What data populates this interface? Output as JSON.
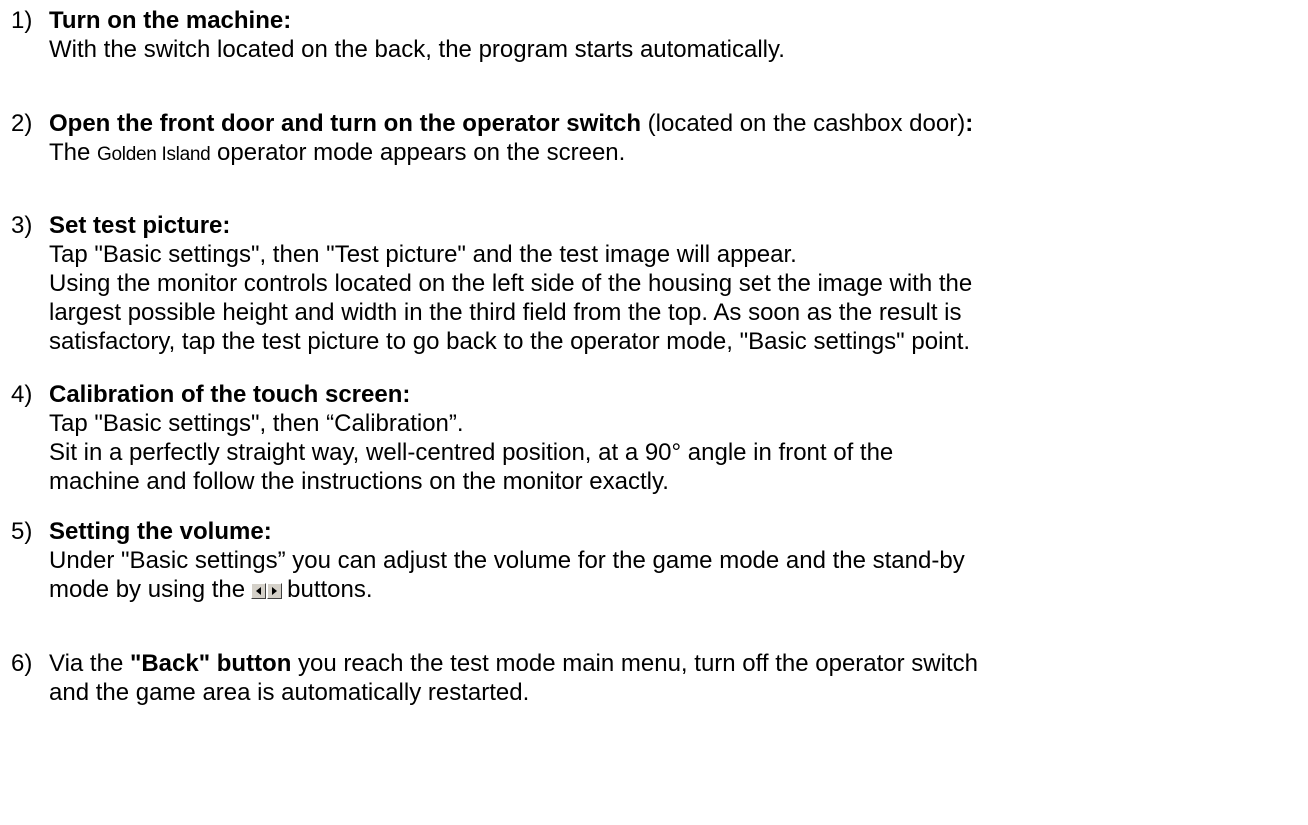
{
  "steps": [
    {
      "num": "1)",
      "title": "Turn on the machine:",
      "lines": [
        "With the switch located on the back, the program starts automatically."
      ]
    },
    {
      "num": "2)",
      "title": "Open the front door and turn on the operator switch",
      "title_suffix": " (located on the cashbox door)",
      "title_colon": ":",
      "line_pre": "The ",
      "brand": "Golden Island",
      "line_post": " operator mode appears on the screen."
    },
    {
      "num": "3)",
      "title": "Set test picture:",
      "lines": [
        "Tap \"Basic settings\", then \"Test picture\" and the test image will appear.",
        "Using the monitor controls located on the left side of the housing set the image with the",
        "largest possible height and width in the third field from the top. As soon as the result is",
        "satisfactory, tap the test picture to go back to the operator mode, \"Basic settings\" point."
      ]
    },
    {
      "num": "4)",
      "title": "Calibration of the touch screen:",
      "lines": [
        "Tap \"Basic settings\", then “Calibration”.",
        "Sit in a perfectly straight way, well-centred position, at a 90° angle in front of the",
        "machine and follow the instructions on the monitor exactly."
      ]
    },
    {
      "num": "5)",
      "title": "Setting the volume:",
      "line1": "Under \"Basic settings” you can adjust the volume for the game mode and the stand-by",
      "line2_pre": "mode by using the",
      "line2_post": "buttons.",
      "icons": [
        "left-arrow-icon",
        "right-arrow-icon"
      ]
    },
    {
      "num": "6)",
      "pre": "Via the ",
      "bold": "\"Back\" button",
      "post": " you reach the test mode main menu, turn off the operator switch",
      "line2": "and the game area is automatically restarted."
    }
  ]
}
